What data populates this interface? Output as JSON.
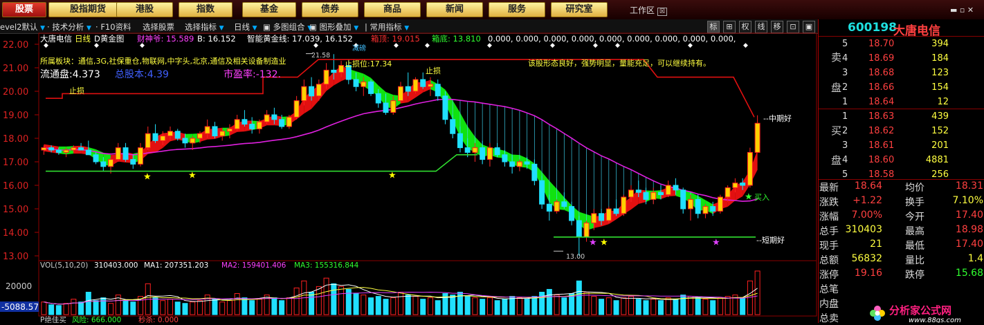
{
  "menu": {
    "tabs": [
      "股票",
      "股指期货",
      "港股",
      "指数",
      "基金",
      "债券",
      "商品",
      "新闻",
      "服务",
      "研究室"
    ],
    "workarea": "工作区",
    "controls": "▬ ▫ ✕"
  },
  "toolbar": {
    "items": [
      "evel2默认",
      "技术分析",
      "F10资料",
      "选择股票",
      "选择指标",
      "日线",
      "多图组合",
      "图形叠加",
      "常用指标"
    ],
    "right_buttons": [
      "标",
      "⊞",
      "权",
      "线",
      "移",
      "⊡",
      "▣"
    ]
  },
  "chart_header": {
    "title": "大唐电信",
    "period": "日线",
    "indicator": "D黄金图",
    "items": [
      {
        "label": "财神爷:",
        "value": "15.589",
        "color": "#ff40ff"
      },
      {
        "label": "B:",
        "value": "16.152",
        "color": "#ffffff"
      },
      {
        "label": "智能黄金线:",
        "value": "17.039",
        "color": "#ffffff"
      },
      {
        "label": "16.152",
        "value": "",
        "color": "#ffffff"
      },
      {
        "label": "箱顶:",
        "value": "19.015",
        "color": "#ff3030"
      },
      {
        "label": "箱底:",
        "value": "13.810",
        "color": "#30ff30"
      },
      {
        "label": "0.000, 0.000, 0.000, 0.000, 0.000, 0.000, 0.000, 0.000, 0.000,",
        "value": "",
        "color": "#ffffff"
      }
    ]
  },
  "annotations": {
    "sector": "所属板块：通信,3G,社保重仓,物联网,中字头,北京,通信及相关设备制造业",
    "float_cap_label": "流通盘:",
    "float_cap": "4.373",
    "total_cap_label": "总股本:",
    "total_cap": "4.39",
    "pe_label": "市盈率:",
    "pe": "-132.",
    "comment": "该股形态良好，强势明显，量能充足，可以继续持有。",
    "stop_loss_1": "止损",
    "stop_loss_2": "止损位:17.34",
    "stop_loss_3": "止损",
    "peak": "21.58",
    "low": "13.00",
    "mid_term": "中期好",
    "short_term": "短期好",
    "buy": "买入",
    "reduce": "减磅"
  },
  "price_axis": [
    "22.00",
    "21.00",
    "20.00",
    "19.00",
    "18.00",
    "17.00",
    "16.00",
    "15.00",
    "14.00",
    "13.00"
  ],
  "volume_header": {
    "label": "VOL(5,10,20)",
    "vol": "310403.000",
    "ma1": "MA1: 207351.203",
    "ma2": "MA2: 159401.406",
    "ma3": "MA3: 155316.844"
  },
  "volume_axis": {
    "tick": "20000",
    "readout": "-5088.57"
  },
  "bottom_indicator": {
    "label": "P绝佳买",
    "f1": "风险: 666.000",
    "f2": "秒杀: 0.000"
  },
  "quote": {
    "code": "600198",
    "name": "大唐电信",
    "sell_label": [
      "卖",
      "盘"
    ],
    "buy_label": [
      "买",
      "盘"
    ],
    "asks": [
      {
        "lvl": "5",
        "price": "18.70",
        "vol": "394"
      },
      {
        "lvl": "4",
        "price": "18.69",
        "vol": "184"
      },
      {
        "lvl": "3",
        "price": "18.68",
        "vol": "123"
      },
      {
        "lvl": "2",
        "price": "18.66",
        "vol": "154"
      },
      {
        "lvl": "1",
        "price": "18.64",
        "vol": "12"
      }
    ],
    "bids": [
      {
        "lvl": "1",
        "price": "18.63",
        "vol": "439"
      },
      {
        "lvl": "2",
        "price": "18.62",
        "vol": "152"
      },
      {
        "lvl": "3",
        "price": "18.61",
        "vol": "201"
      },
      {
        "lvl": "4",
        "price": "18.60",
        "vol": "4881"
      },
      {
        "lvl": "5",
        "price": "18.58",
        "vol": "256"
      }
    ],
    "stats": [
      {
        "l": "最新",
        "v": "18.64",
        "l2": "均价",
        "v2": "18.31",
        "c": "#ff4040",
        "c2": "#ff4040"
      },
      {
        "l": "涨跌",
        "v": "+1.22",
        "l2": "换手",
        "v2": "7.10%",
        "c": "#ff4040",
        "c2": "#ffff40"
      },
      {
        "l": "涨幅",
        "v": "7.00%",
        "l2": "今开",
        "v2": "17.40",
        "c": "#ff4040",
        "c2": "#ff4040"
      },
      {
        "l": "总手",
        "v": "310403",
        "l2": "最高",
        "v2": "18.98",
        "c": "#ffff40",
        "c2": "#ff4040"
      },
      {
        "l": "现手",
        "v": "21",
        "l2": "最低",
        "v2": "17.40",
        "c": "#ffff40",
        "c2": "#ff4040"
      },
      {
        "l": "总额",
        "v": "56832",
        "l2": "量比",
        "v2": "1.4",
        "c": "#ffff40",
        "c2": "#ffff40"
      },
      {
        "l": "涨停",
        "v": "19.16",
        "l2": "跌停",
        "v2": "15.68",
        "c": "#ff4040",
        "c2": "#30ff30"
      },
      {
        "l": "总笔",
        "v": "",
        "l2": "",
        "v2": "",
        "c": "#ffff40",
        "c2": "#ffff40"
      },
      {
        "l": "内盘",
        "v": "",
        "l2": "",
        "v2": "",
        "c": "#30ff30",
        "c2": "#ff4040"
      },
      {
        "l": "总卖",
        "v": "",
        "l2": "",
        "v2": "",
        "c": "#ffff40",
        "c2": "#ffff40"
      }
    ]
  },
  "watermark": {
    "line1": "分析家公式网",
    "line2": "www.88gs.com"
  },
  "chart_data": {
    "type": "candlestick",
    "ylim": [
      13.0,
      22.0
    ],
    "candles": [
      [
        17.5,
        17.7,
        17.3,
        17.6
      ],
      [
        17.6,
        17.7,
        17.4,
        17.5
      ],
      [
        17.5,
        17.6,
        17.3,
        17.4
      ],
      [
        17.4,
        17.6,
        17.2,
        17.5
      ],
      [
        17.5,
        17.7,
        17.4,
        17.6
      ],
      [
        17.6,
        17.8,
        17.5,
        17.5
      ],
      [
        17.5,
        17.9,
        17.3,
        17.3
      ],
      [
        17.3,
        17.4,
        16.9,
        17.0
      ],
      [
        17.0,
        17.2,
        16.6,
        16.8
      ],
      [
        16.8,
        17.2,
        16.5,
        17.1
      ],
      [
        17.1,
        17.8,
        17.0,
        17.6
      ],
      [
        17.6,
        17.8,
        17.0,
        17.1
      ],
      [
        17.1,
        17.3,
        16.7,
        16.9
      ],
      [
        16.9,
        17.8,
        16.8,
        17.6
      ],
      [
        17.6,
        18.5,
        17.5,
        18.2
      ],
      [
        18.2,
        18.6,
        17.8,
        17.9
      ],
      [
        17.9,
        18.3,
        17.7,
        18.1
      ],
      [
        18.1,
        18.5,
        17.9,
        18.3
      ],
      [
        18.3,
        18.4,
        17.9,
        18.0
      ],
      [
        18.0,
        18.2,
        17.6,
        17.8
      ],
      [
        17.8,
        18.1,
        17.5,
        18.0
      ],
      [
        18.0,
        18.3,
        17.8,
        18.2
      ],
      [
        18.2,
        18.8,
        18.0,
        18.5
      ],
      [
        18.5,
        18.7,
        18.0,
        18.1
      ],
      [
        18.1,
        18.4,
        17.9,
        18.3
      ],
      [
        18.3,
        18.6,
        18.0,
        18.4
      ],
      [
        18.4,
        19.0,
        18.3,
        18.8
      ],
      [
        18.8,
        19.2,
        18.5,
        18.6
      ],
      [
        18.6,
        18.9,
        18.2,
        18.4
      ],
      [
        18.4,
        18.8,
        18.2,
        18.7
      ],
      [
        18.7,
        19.2,
        18.6,
        19.0
      ],
      [
        19.0,
        19.3,
        18.6,
        18.8
      ],
      [
        18.8,
        19.0,
        18.4,
        18.5
      ],
      [
        18.5,
        19.0,
        18.4,
        18.9
      ],
      [
        18.9,
        19.8,
        18.8,
        19.6
      ],
      [
        19.6,
        20.5,
        19.4,
        20.2
      ],
      [
        20.2,
        20.6,
        19.6,
        19.8
      ],
      [
        19.8,
        20.5,
        19.6,
        20.3
      ],
      [
        20.3,
        21.2,
        20.1,
        20.9
      ],
      [
        20.9,
        21.58,
        20.5,
        20.8
      ],
      [
        20.8,
        21.3,
        20.6,
        21.1
      ],
      [
        21.1,
        21.3,
        20.3,
        20.5
      ],
      [
        20.5,
        20.8,
        20.0,
        20.2
      ],
      [
        20.2,
        20.6,
        19.8,
        20.4
      ],
      [
        20.4,
        20.5,
        19.8,
        19.9
      ],
      [
        19.9,
        20.1,
        19.3,
        19.5
      ],
      [
        19.5,
        19.9,
        19.0,
        19.1
      ],
      [
        19.1,
        19.8,
        19.0,
        19.6
      ],
      [
        19.6,
        20.4,
        19.5,
        20.2
      ],
      [
        20.2,
        20.8,
        19.8,
        20.0
      ],
      [
        20.0,
        20.6,
        19.9,
        20.5
      ],
      [
        20.5,
        20.8,
        20.1,
        20.2
      ],
      [
        20.2,
        20.6,
        19.8,
        20.3
      ],
      [
        20.3,
        20.5,
        19.6,
        19.8
      ],
      [
        19.8,
        20.0,
        18.6,
        18.8
      ],
      [
        18.8,
        19.0,
        18.0,
        18.2
      ],
      [
        18.2,
        18.5,
        17.4,
        17.6
      ],
      [
        17.6,
        18.0,
        17.2,
        17.4
      ],
      [
        17.4,
        17.8,
        17.0,
        17.6
      ],
      [
        17.6,
        17.9,
        16.9,
        17.1
      ],
      [
        17.1,
        17.8,
        16.8,
        17.6
      ],
      [
        17.6,
        17.8,
        17.2,
        17.3
      ],
      [
        17.3,
        17.5,
        16.8,
        17.0
      ],
      [
        17.0,
        17.3,
        16.5,
        16.8
      ],
      [
        16.8,
        17.1,
        16.6,
        17.0
      ],
      [
        17.0,
        17.2,
        16.7,
        16.9
      ],
      [
        16.9,
        17.1,
        16.0,
        16.2
      ],
      [
        16.2,
        16.4,
        15.0,
        15.2
      ],
      [
        15.2,
        15.6,
        14.5,
        14.9
      ],
      [
        14.9,
        15.4,
        14.8,
        15.3
      ],
      [
        15.3,
        15.7,
        15.0,
        15.1
      ],
      [
        15.1,
        15.3,
        14.3,
        14.5
      ],
      [
        14.5,
        14.7,
        13.0,
        13.8
      ],
      [
        13.8,
        14.5,
        13.6,
        14.4
      ],
      [
        14.4,
        15.0,
        14.1,
        14.8
      ],
      [
        14.8,
        15.0,
        14.3,
        14.5
      ],
      [
        14.5,
        15.1,
        14.4,
        15.0
      ],
      [
        15.0,
        15.4,
        14.7,
        14.8
      ],
      [
        14.8,
        15.6,
        14.7,
        15.5
      ],
      [
        15.5,
        16.0,
        15.3,
        15.8
      ],
      [
        15.8,
        16.2,
        15.5,
        15.7
      ],
      [
        15.7,
        15.9,
        15.2,
        15.4
      ],
      [
        15.4,
        15.9,
        15.2,
        15.7
      ],
      [
        15.7,
        16.0,
        15.4,
        15.6
      ],
      [
        15.6,
        16.2,
        15.5,
        16.0
      ],
      [
        16.0,
        16.3,
        15.6,
        15.8
      ],
      [
        15.8,
        15.9,
        14.8,
        15.0
      ],
      [
        15.0,
        15.6,
        14.5,
        15.4
      ],
      [
        15.4,
        15.6,
        14.6,
        14.8
      ],
      [
        14.8,
        15.2,
        14.6,
        15.1
      ],
      [
        15.1,
        15.3,
        14.7,
        14.9
      ],
      [
        14.9,
        15.6,
        14.8,
        15.5
      ],
      [
        15.5,
        16.0,
        15.3,
        15.9
      ],
      [
        15.9,
        16.3,
        15.7,
        16.1
      ],
      [
        16.1,
        16.3,
        15.8,
        16.0
      ],
      [
        16.0,
        17.6,
        15.9,
        17.4
      ],
      [
        17.4,
        18.98,
        17.4,
        18.64
      ]
    ],
    "volume": [
      9000,
      7000,
      6500,
      8000,
      11000,
      9000,
      16000,
      10000,
      12000,
      8000,
      14000,
      10000,
      9000,
      13000,
      22000,
      12000,
      10000,
      11000,
      9000,
      8000,
      9000,
      10000,
      14000,
      11000,
      9000,
      10000,
      15000,
      12000,
      10000,
      11000,
      14000,
      12000,
      10000,
      12000,
      19000,
      24000,
      16000,
      20000,
      26000,
      22000,
      20000,
      18000,
      15000,
      14000,
      12000,
      13000,
      11000,
      12000,
      16000,
      14000,
      13000,
      11000,
      12000,
      10000,
      15000,
      14000,
      16000,
      13000,
      12000,
      11000,
      12000,
      10000,
      11000,
      13000,
      12000,
      11000,
      13000,
      16000,
      18000,
      14000,
      12000,
      15000,
      24000,
      16000,
      13000,
      11000,
      12000,
      10000,
      12000,
      13000,
      11000,
      10000,
      11000,
      10000,
      12000,
      11000,
      14000,
      13000,
      12000,
      11000,
      10000,
      12000,
      13000,
      14000,
      12000,
      24000,
      31040
    ]
  }
}
